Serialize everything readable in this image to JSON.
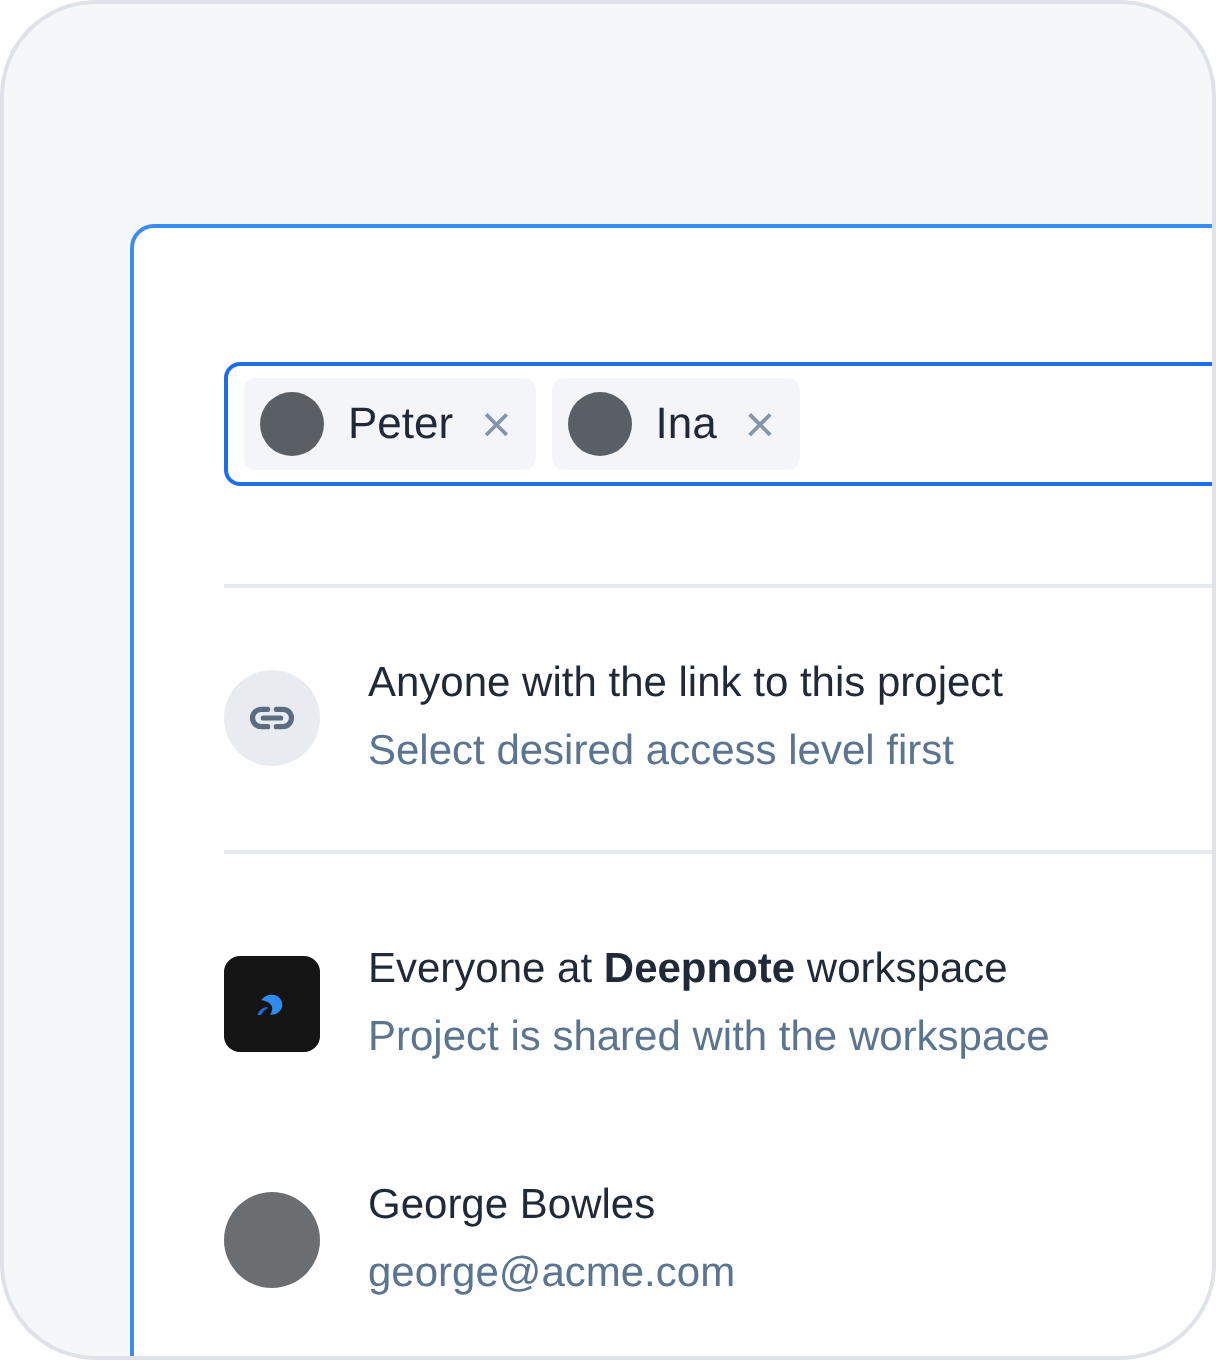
{
  "invite_field": {
    "chips": [
      {
        "name": "Peter",
        "remove": "×"
      },
      {
        "name": "Ina",
        "remove": "×"
      }
    ]
  },
  "access_list": [
    {
      "kind": "link",
      "title": "Anyone with the link to this project",
      "subtitle": "Select desired access level first",
      "divider_after": true
    },
    {
      "kind": "workspace",
      "title": "Everyone at **Deepnote** workspace",
      "subtitle": "Project is shared with the workspace",
      "divider_after": false
    },
    {
      "kind": "person",
      "title": "George Bowles",
      "subtitle": "george@acme.com",
      "divider_after": false
    }
  ]
}
